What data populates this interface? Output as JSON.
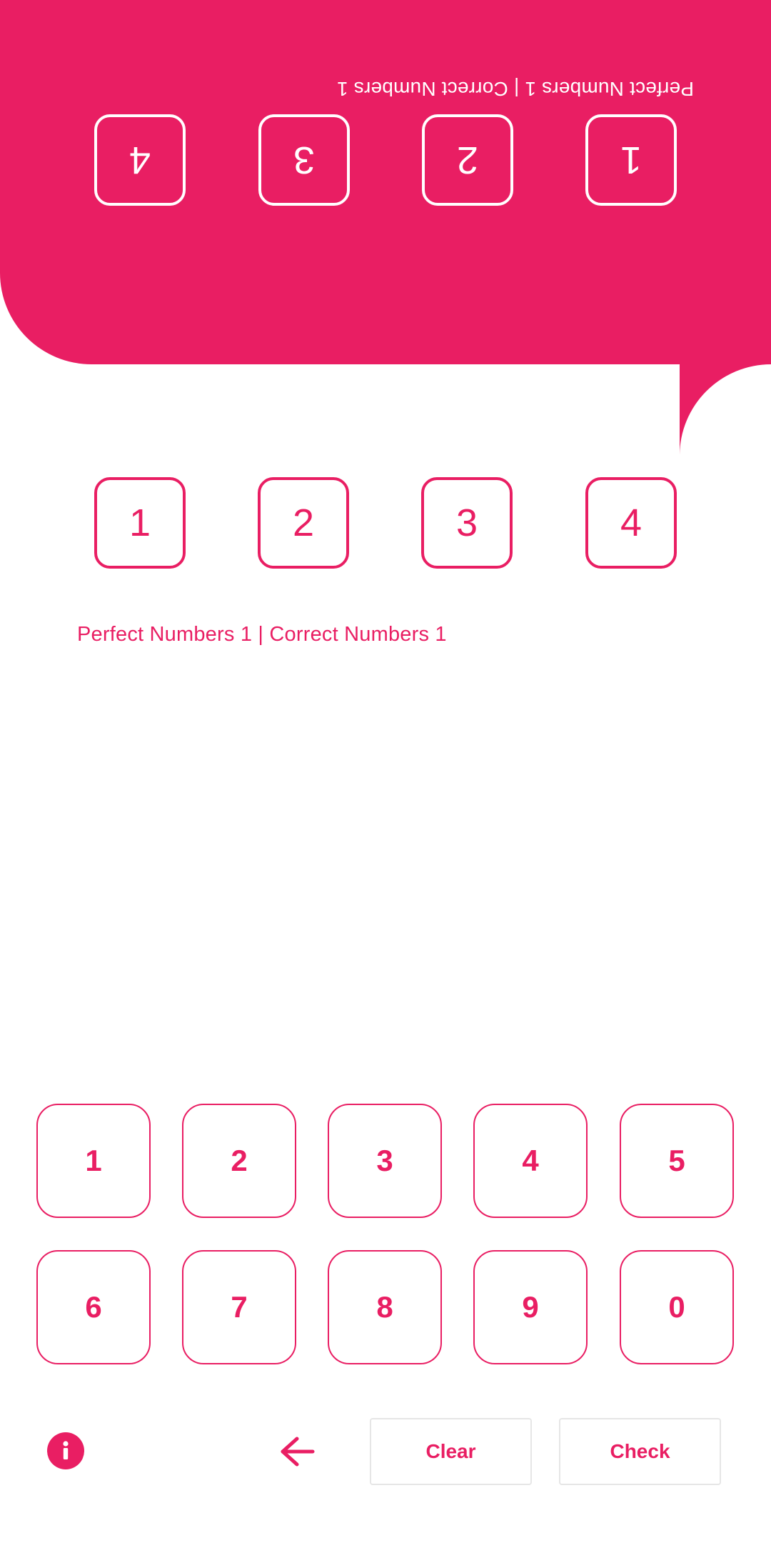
{
  "opponent": {
    "status": "Perfect Numbers 1 | Correct Numbers 1",
    "slots": [
      "1",
      "2",
      "3",
      "4"
    ]
  },
  "player": {
    "slots": [
      "1",
      "2",
      "3",
      "4"
    ],
    "status": "Perfect Numbers 1 | Correct Numbers 1"
  },
  "keypad": {
    "keys": [
      "1",
      "2",
      "3",
      "4",
      "5",
      "6",
      "7",
      "8",
      "9",
      "0"
    ]
  },
  "actions": {
    "info_icon": "info-icon",
    "back_icon": "arrow-left-icon",
    "clear_label": "Clear",
    "check_label": "Check"
  },
  "colors": {
    "accent": "#E91E63",
    "background": "#FFFFFF",
    "button_border": "#E6E6E6"
  }
}
